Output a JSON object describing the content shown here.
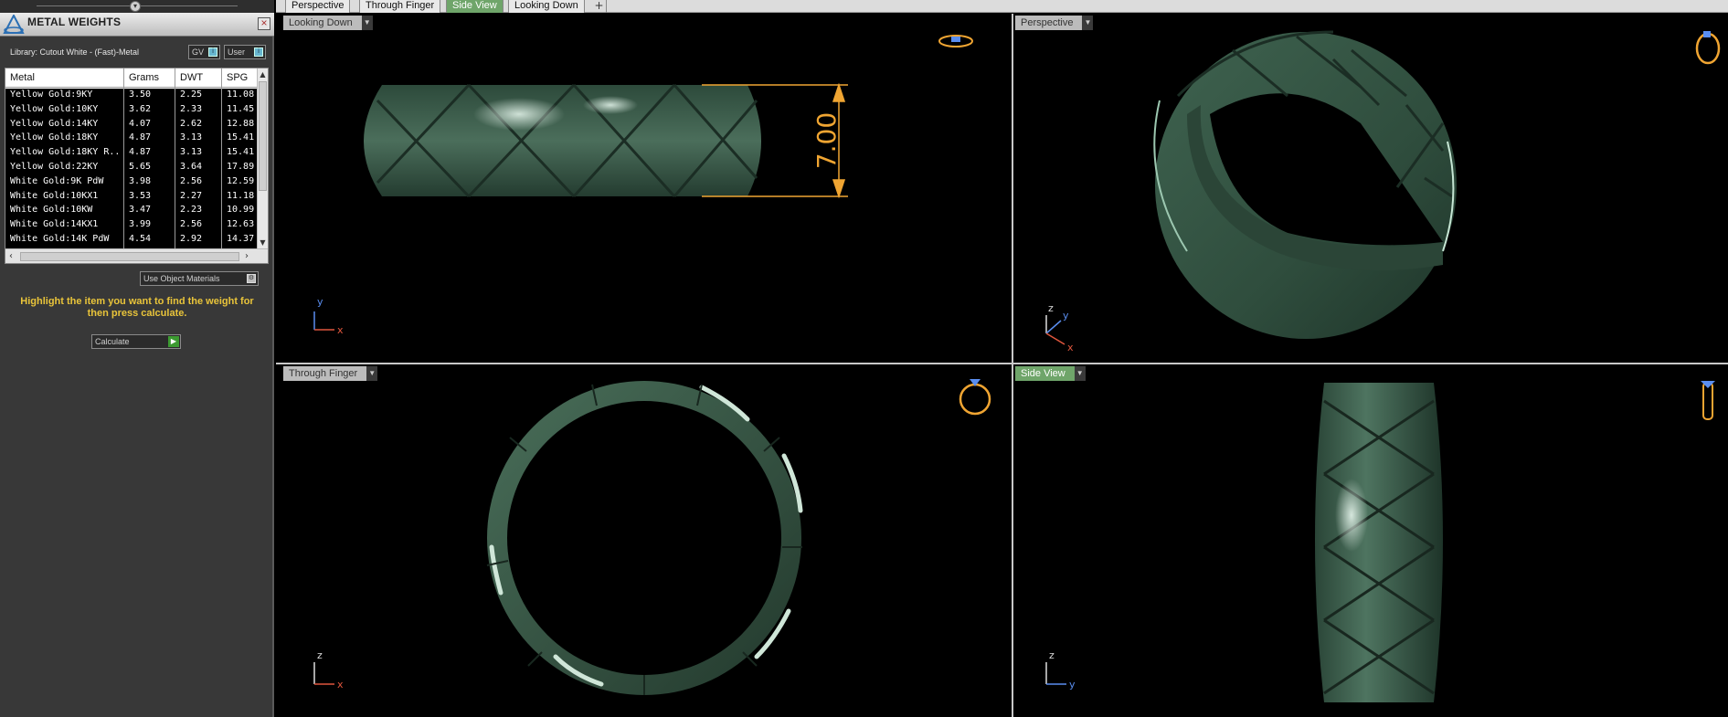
{
  "panel": {
    "title": "METAL WEIGHTS",
    "library": "Library: Cutout White - (Fast)-Metal",
    "gv_label": "GV",
    "user_label": "User",
    "columns": [
      "Metal",
      "Grams",
      "DWT",
      "SPG"
    ],
    "rows": [
      [
        "Yellow Gold:9KY",
        "3.50",
        "2.25",
        "11.08"
      ],
      [
        "Yellow Gold:10KY",
        "3.62",
        "2.33",
        "11.45"
      ],
      [
        "Yellow Gold:14KY",
        "4.07",
        "2.62",
        "12.88"
      ],
      [
        "Yellow Gold:18KY",
        "4.87",
        "3.13",
        "15.41"
      ],
      [
        "Yellow Gold:18KY R...",
        "4.87",
        "3.13",
        "15.41"
      ],
      [
        "Yellow Gold:22KY",
        "5.65",
        "3.64",
        "17.89"
      ],
      [
        "White Gold:9K PdW",
        "3.98",
        "2.56",
        "12.59"
      ],
      [
        "White Gold:10KX1",
        "3.53",
        "2.27",
        "11.18"
      ],
      [
        "White Gold:10KW",
        "3.47",
        "2.23",
        "10.99"
      ],
      [
        "White Gold:14KX1",
        "3.99",
        "2.56",
        "12.63"
      ],
      [
        "White Gold:14K PdW",
        "4.54",
        "2.92",
        "14.37"
      ]
    ],
    "use_object_materials": "Use Object Materials",
    "hint": "Highlight the item you want to find the weight for then press calculate.",
    "calculate": "Calculate"
  },
  "tabs": [
    "Perspective",
    "Through Finger",
    "Side View",
    "Looking Down"
  ],
  "active_tab": "Side View",
  "viewports": {
    "top_left": {
      "label": "Looking Down",
      "dimension": "7.00",
      "axes": [
        "y",
        "x"
      ]
    },
    "top_right": {
      "label": "Perspective",
      "axes": [
        "z",
        "y",
        "x"
      ]
    },
    "bottom_left": {
      "label": "Through Finger",
      "axes": [
        "z",
        "x"
      ]
    },
    "bottom_right": {
      "label": "Side View",
      "axes": [
        "z",
        "y"
      ]
    }
  },
  "colors": {
    "ring_green": "#3d5e4c",
    "dimension_orange": "#f0a532",
    "hint_yellow": "#e9c43a",
    "active_tab_green": "#6fa56a"
  }
}
